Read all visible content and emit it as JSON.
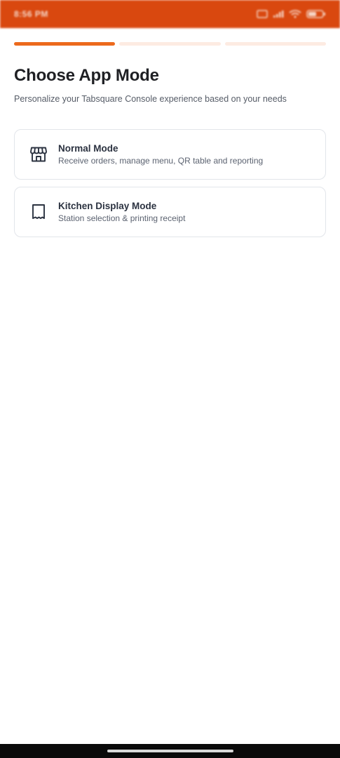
{
  "status_bar": {
    "time": "8:56 PM",
    "icons": [
      "sim-icon",
      "signal-icon",
      "wifi-icon",
      "battery-icon"
    ],
    "background": "#d9480f"
  },
  "progress": {
    "current_step": 1,
    "total_steps": 3,
    "active_color": "#ec6a1d"
  },
  "header": {
    "title": "Choose App Mode",
    "subtitle": "Personalize your Tabsquare Console experience based on your needs"
  },
  "modes": [
    {
      "icon": "store-icon",
      "title": "Normal Mode",
      "description": "Receive orders, manage menu, QR table and reporting"
    },
    {
      "icon": "receipt-icon",
      "title": "Kitchen Display Mode",
      "description": "Station selection & printing receipt"
    }
  ]
}
